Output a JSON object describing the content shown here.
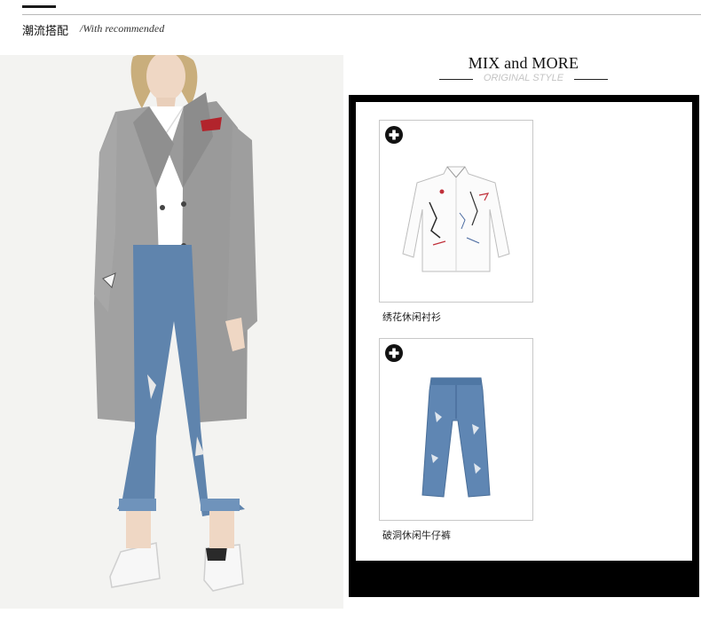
{
  "header": {
    "title": "潮流搭配",
    "subtitle": "/With recommended"
  },
  "mix_panel": {
    "title": "MIX and MORE",
    "subtitle": "ORIGINAL STYLE"
  },
  "products": [
    {
      "name": "绣花休闲衬衫",
      "icon": "plus-circle-icon"
    },
    {
      "name": "破洞休闲牛仔裤",
      "icon": "plus-circle-icon"
    }
  ],
  "colors": {
    "frame": "#000000",
    "coat": "#9c9c9c",
    "denim": "#5b7fa8"
  }
}
